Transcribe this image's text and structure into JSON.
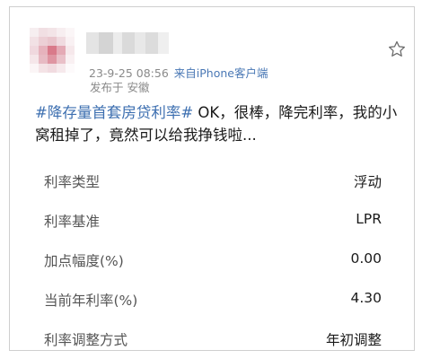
{
  "post": {
    "timestamp": "23-9-25 08:56",
    "source": "来自iPhone客户端",
    "location": "发布于 安徽",
    "hashtag": "#降存量首套房贷利率#",
    "body": " OK，很棒，降完利率，我的小窝租掉了，竟然可以给我挣钱啦..."
  },
  "table": {
    "rows": [
      {
        "label": "利率类型",
        "value": "浮动"
      },
      {
        "label": "利率基准",
        "value": "LPR"
      },
      {
        "label": "加点幅度(%)",
        "value": "0.00"
      },
      {
        "label": "当前年利率(%)",
        "value": "4.30"
      },
      {
        "label": "利率调整方式",
        "value": "年初调整"
      }
    ]
  },
  "icons": {
    "favorite": "star-outline-icon",
    "avatar": "pixelated-avatar"
  },
  "colors": {
    "hashtag": "#3d6fb0",
    "source": "#4a78b5",
    "meta": "#8a8a8a"
  }
}
